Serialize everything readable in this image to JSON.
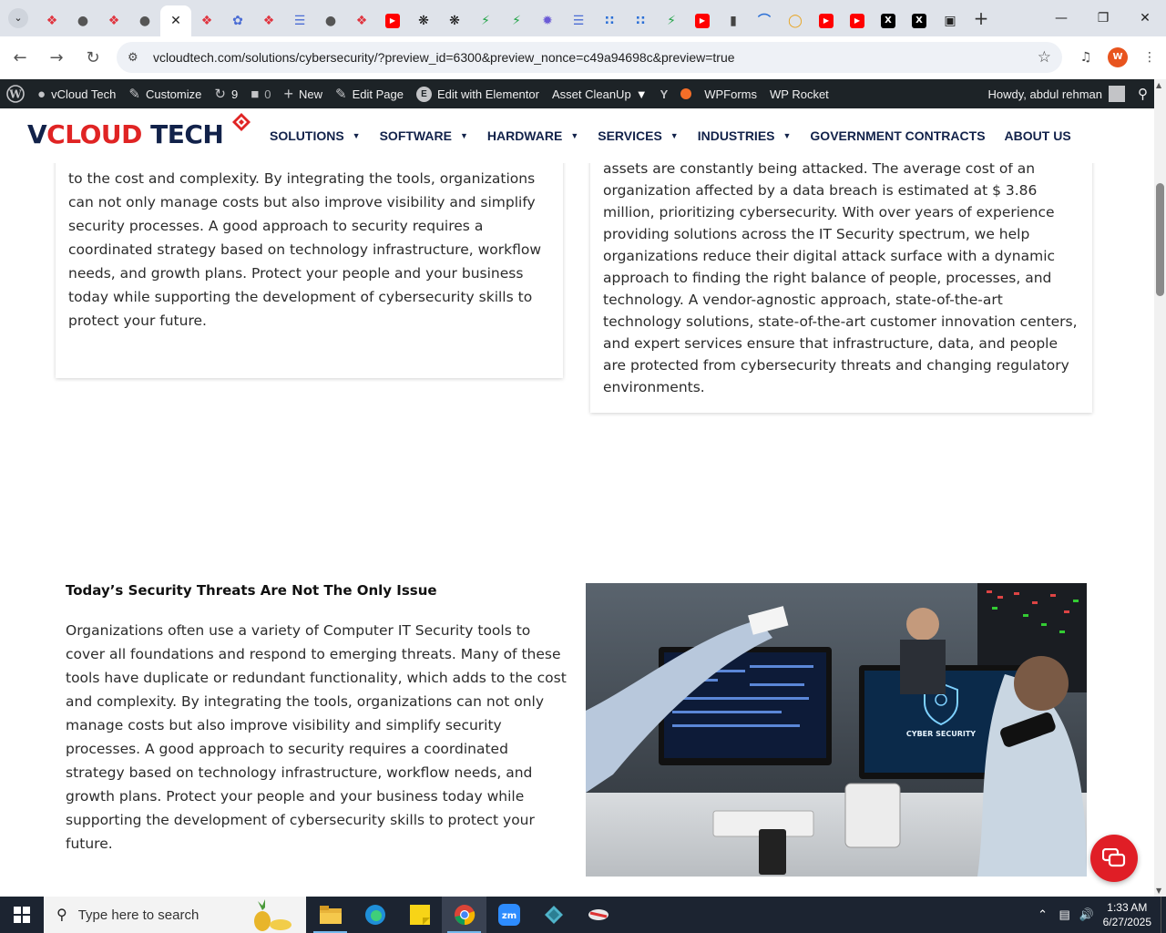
{
  "browser": {
    "tabs": [
      {
        "icon": "pinwheel-icon",
        "color": "#e0343f"
      },
      {
        "icon": "globe-icon",
        "color": "#555555"
      },
      {
        "icon": "pinwheel-icon",
        "color": "#e0343f"
      },
      {
        "icon": "globe-icon",
        "color": "#555555"
      },
      {
        "icon": "close-icon",
        "color": "#222222",
        "active": true
      },
      {
        "icon": "pinwheel-icon",
        "color": "#e0343f"
      },
      {
        "icon": "dragon-icon",
        "color": "#4a6cd4"
      },
      {
        "icon": "pinwheel-icon",
        "color": "#e0343f"
      },
      {
        "icon": "translate-icon",
        "color": "#4a6cd4"
      },
      {
        "icon": "globe-icon",
        "color": "#555555"
      },
      {
        "icon": "pinwheel-icon",
        "color": "#e0343f"
      },
      {
        "icon": "youtube-icon",
        "color": "#ff0000"
      },
      {
        "icon": "openai-icon",
        "color": "#111111"
      },
      {
        "icon": "openai-icon",
        "color": "#111111"
      },
      {
        "icon": "lightning-icon",
        "color": "#22a447"
      },
      {
        "icon": "lightning-icon",
        "color": "#22a447"
      },
      {
        "icon": "swirl-icon",
        "color": "#6b5bd6"
      },
      {
        "icon": "translate-icon",
        "color": "#4a6cd4"
      },
      {
        "icon": "dots-icon",
        "color": "#2a6fd6"
      },
      {
        "icon": "dots-icon",
        "color": "#2a6fd6"
      },
      {
        "icon": "lightning-icon",
        "color": "#22a447"
      },
      {
        "icon": "youtube-icon",
        "color": "#ff0000"
      },
      {
        "icon": "lock-icon",
        "color": "#444444"
      },
      {
        "icon": "arc-icon",
        "color": "#2a6fd6"
      },
      {
        "icon": "ring-icon",
        "color": "#e8a31e"
      },
      {
        "icon": "youtube-icon",
        "color": "#ff0000"
      },
      {
        "icon": "youtube-icon",
        "color": "#ff0000"
      },
      {
        "icon": "x-icon",
        "color": "#000000",
        "label": "X"
      },
      {
        "icon": "x-icon",
        "color": "#000000",
        "label": "X"
      },
      {
        "icon": "image-icon",
        "color": "#222222"
      }
    ],
    "new_tab_label": "+",
    "url": "vcloudtech.com/solutions/cybersecurity/?preview_id=6300&preview_nonce=c49a94698c&preview=true",
    "profile_initial": "W"
  },
  "adminbar": {
    "site_name": "vCloud Tech",
    "customize": "Customize",
    "updates_count": "9",
    "comments_count": "0",
    "new_label": "New",
    "edit_page": "Edit Page",
    "edit_elementor": "Edit with Elementor",
    "asset_cleanup": "Asset CleanUp",
    "wpforms": "WPForms",
    "wprocket": "WP Rocket",
    "howdy": "Howdy, abdul rehman"
  },
  "site": {
    "logo": {
      "v": "V",
      "cloud": "CLOUD",
      "tech": " TECH"
    },
    "nav": [
      {
        "label": "SOLUTIONS",
        "dropdown": true
      },
      {
        "label": "SOFTWARE",
        "dropdown": true
      },
      {
        "label": "HARDWARE",
        "dropdown": true
      },
      {
        "label": "SERVICES",
        "dropdown": true
      },
      {
        "label": "INDUSTRIES",
        "dropdown": true
      },
      {
        "label": "GOVERNMENT CONTRACTS",
        "dropdown": false
      },
      {
        "label": "ABOUT US",
        "dropdown": false
      }
    ],
    "card_left_text": "to cover all foundations and respond to emerging threats. Many of these tools have duplicate or redundant functionality, which adds to the cost and complexity. By integrating the tools, organizations can not only manage costs but also improve visibility and simplify security processes. A good approach to security requires a coordinated strategy based on technology infrastructure, workflow needs, and growth plans. Protect your people and your business today while supporting the development of cybersecurity skills to protect your future.",
    "card_right_text": "assets are constantly being attacked. The average cost of an organization affected by a data breach is estimated at $ 3.86 million, prioritizing cybersecurity. With over years of experience providing solutions across the IT Security spectrum, we help organizations reduce their digital attack surface with a dynamic approach to finding the right balance of people, processes, and technology. A vendor-agnostic approach, state-of-the-art technology solutions, state-of-the-art customer innovation centers, and expert services ensure that infrastructure, data, and people are protected from cybersecurity threats and changing regulatory environments.",
    "section2_heading": "Today’s Security Threats Are Not The Only Issue",
    "section2_text": "Organizations often use a variety of Computer IT Security tools to cover all foundations and respond to emerging threats. Many of these tools have duplicate or redundant functionality, which adds to the cost and complexity. By integrating the tools, organizations can not only manage costs but also improve visibility and simplify security processes. A good approach to security requires a coordinated strategy based on technology infrastructure, workflow needs, and growth plans. Protect your people and your business today while supporting the development of cybersecurity skills to protect your future.",
    "photo_screen_text": "CYBER SECURITY",
    "accent": "#e01e26",
    "navy": "#12224a"
  },
  "taskbar": {
    "search_placeholder": "Type here to search",
    "time": "1:33 AM",
    "date": "6/27/2025"
  }
}
